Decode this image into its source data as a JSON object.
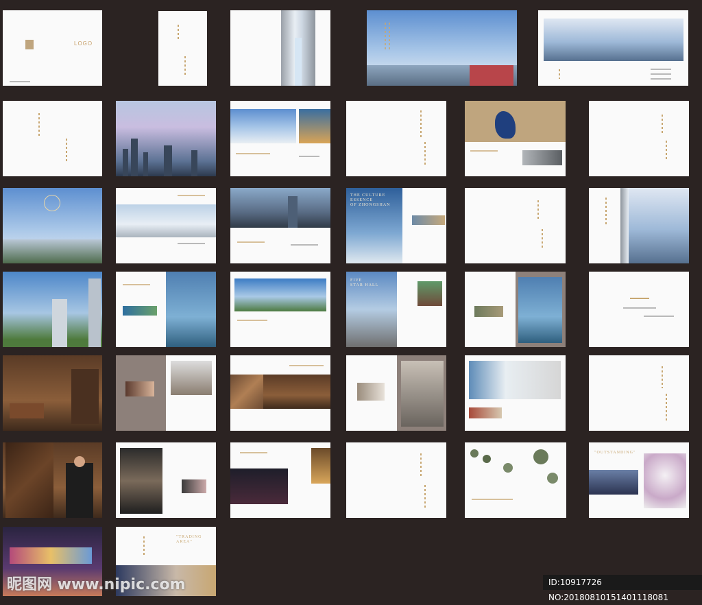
{
  "logo_label": "LOGO",
  "page_texts": {
    "culture_title": "THE CULTURE\nESSENCE\nOF ZHONGSHAN",
    "hall_title": "FIVE\nSTAR HALL",
    "outstanding": "\"OUTSTANDING\"",
    "trading_area": "\"TRADING\nAREA\""
  },
  "watermark": {
    "site": "昵图网 www.nipic.com",
    "id": "ID:10917726 NO:20180810151401118081"
  },
  "colors": {
    "background": "#2b2322",
    "gold": "#c8a772",
    "page": "#fafafa"
  }
}
